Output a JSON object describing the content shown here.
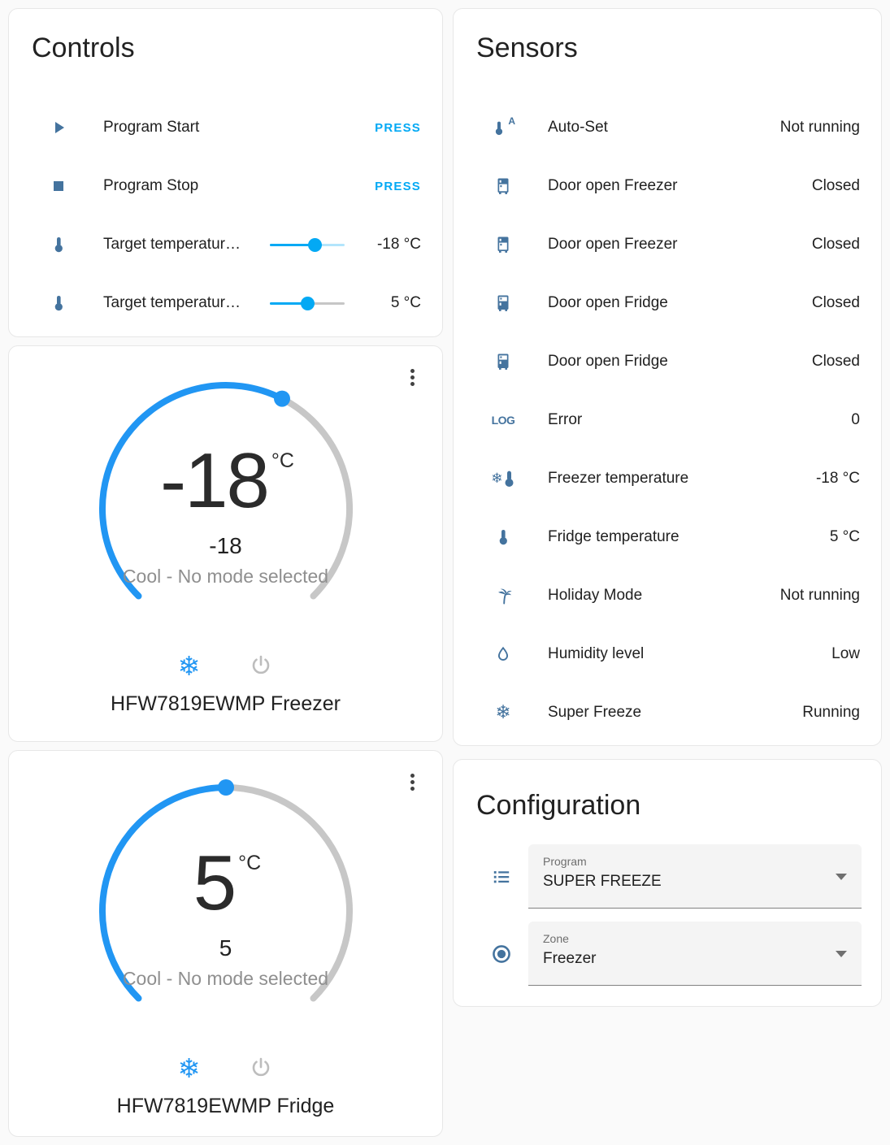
{
  "colors": {
    "accent": "#03a9f4",
    "state_icon": "#44739e",
    "dial_active": "#2196f3",
    "dial_inactive": "#c7c7c7"
  },
  "controls": {
    "title": "Controls",
    "rows": [
      {
        "icon": "play",
        "label": "Program Start",
        "action": "PRESS"
      },
      {
        "icon": "stop",
        "label": "Program Stop",
        "action": "PRESS"
      },
      {
        "icon": "thermometer",
        "label": "Target temperatur…",
        "value": "-18 °C",
        "percent": 60
      },
      {
        "icon": "thermometer",
        "label": "Target temperatur…",
        "value": "5 °C",
        "percent": 50
      }
    ]
  },
  "sensors": {
    "title": "Sensors",
    "rows": [
      {
        "icon": "thermometer-auto",
        "label": "Auto-Set",
        "value": "Not running"
      },
      {
        "icon": "fridge-bottom",
        "label": "Door open Freezer",
        "value": "Closed"
      },
      {
        "icon": "fridge-bottom",
        "label": "Door open Freezer",
        "value": "Closed"
      },
      {
        "icon": "fridge-top",
        "label": "Door open Fridge",
        "value": "Closed"
      },
      {
        "icon": "fridge-top",
        "label": "Door open Fridge",
        "value": "Closed"
      },
      {
        "icon": "log",
        "icon_text": "LOG",
        "label": "Error",
        "value": "0"
      },
      {
        "icon": "snowflake-thermometer",
        "label": "Freezer temperature",
        "value": "-18 °C"
      },
      {
        "icon": "thermometer",
        "label": "Fridge temperature",
        "value": "5 °C"
      },
      {
        "icon": "palm-tree",
        "label": "Holiday Mode",
        "value": "Not running"
      },
      {
        "icon": "water-drop",
        "label": "Humidity level",
        "value": "Low"
      },
      {
        "icon": "snowflake",
        "label": "Super Freeze",
        "value": "Running"
      }
    ]
  },
  "freezer": {
    "temp": "-18",
    "unit": "°C",
    "current": "-18",
    "mode": "Cool - No mode selected",
    "name": "HFW7819EWMP Freezer",
    "snowflake": "❄"
  },
  "fridge": {
    "temp": "5",
    "unit": "°C",
    "current": "5",
    "mode": "Cool - No mode selected",
    "name": "HFW7819EWMP Fridge",
    "snowflake": "❄"
  },
  "config": {
    "title": "Configuration",
    "program": {
      "label": "Program",
      "value": "SUPER FREEZE"
    },
    "zone": {
      "label": "Zone",
      "value": "Freezer"
    }
  }
}
